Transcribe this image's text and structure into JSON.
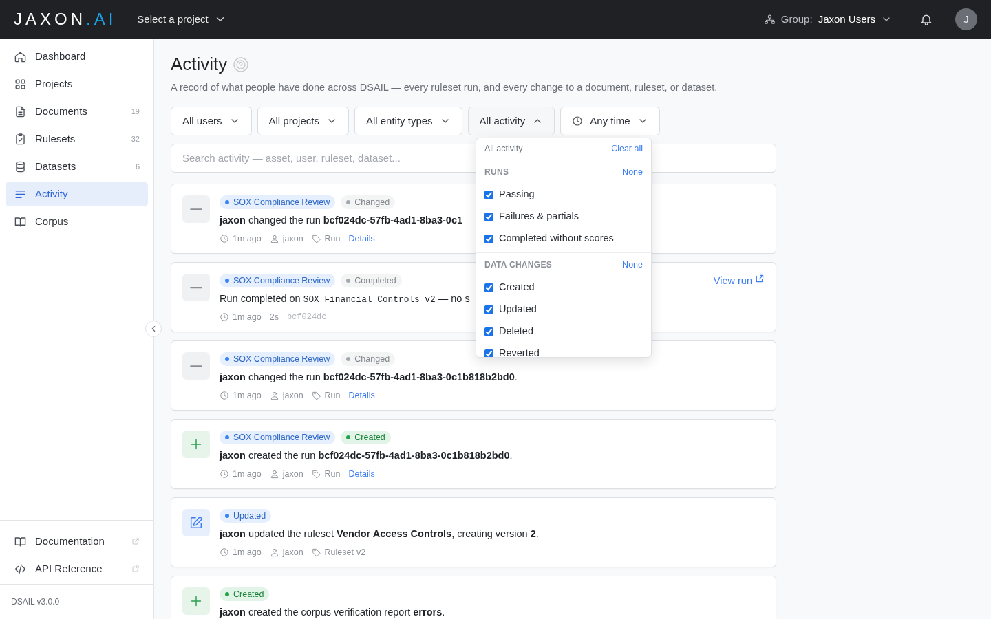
{
  "navbar": {
    "logo": {
      "main": "JAXON",
      "accent": ".AI"
    },
    "project_selector": "Select a project",
    "group": {
      "label": "Group:",
      "value": "Jaxon Users"
    },
    "avatar": "J"
  },
  "sidebar": {
    "items": [
      {
        "label": "Dashboard",
        "kind": "home",
        "selected": false
      },
      {
        "label": "Projects",
        "kind": "grid",
        "selected": false
      },
      {
        "label": "Documents",
        "kind": "doc",
        "count": "19",
        "selected": false
      },
      {
        "label": "Rulesets",
        "kind": "clipboard",
        "count": "32",
        "selected": false
      },
      {
        "label": "Datasets",
        "kind": "database",
        "count": "6",
        "selected": false
      },
      {
        "label": "Activity",
        "kind": "lines",
        "selected": true
      },
      {
        "label": "Corpus",
        "kind": "book",
        "selected": false
      }
    ],
    "links": [
      {
        "label": "Documentation",
        "kind": "book"
      },
      {
        "label": "API Reference",
        "kind": "code"
      }
    ],
    "version": "DSAIL v3.0.0"
  },
  "page": {
    "title": "Activity",
    "subtitle": "A record of what people have done across DSAIL — every ruleset run, and every change to a document, ruleset, or dataset."
  },
  "filters": [
    {
      "label": "All users",
      "kind": "select",
      "expanded": false
    },
    {
      "label": "All projects",
      "kind": "select",
      "expanded": false
    },
    {
      "label": "All entity types",
      "kind": "select",
      "expanded": false
    },
    {
      "label": "All activity",
      "kind": "select",
      "expanded": true
    },
    {
      "label": "Any time",
      "kind": "time",
      "expanded": false
    }
  ],
  "search": {
    "placeholder": "Search activity — asset, user, ruleset, dataset..."
  },
  "dropdown": {
    "title": "All activity",
    "clear": "Clear all",
    "sections": [
      {
        "title": "RUNS",
        "action": "None",
        "options": [
          {
            "label": "Passing",
            "checked": true
          },
          {
            "label": "Failures & partials",
            "checked": true
          },
          {
            "label": "Completed without scores",
            "checked": true
          }
        ]
      },
      {
        "title": "DATA CHANGES",
        "action": "None",
        "options": [
          {
            "label": "Created",
            "checked": true
          },
          {
            "label": "Updated",
            "checked": true
          },
          {
            "label": "Deleted",
            "checked": true
          },
          {
            "label": "Reverted",
            "checked": true
          }
        ]
      }
    ]
  },
  "activities": [
    {
      "kind": "neutral",
      "tags": [
        {
          "text": "SOX Compliance Review",
          "color": "#3b82f6"
        },
        {
          "text": "Changed",
          "color": "#a3a7ae"
        }
      ],
      "message": [
        {
          "kind": "bold",
          "text": "jaxon"
        },
        {
          "kind": "text",
          "text": " changed the run "
        },
        {
          "kind": "bold",
          "text": "bcf024dc-57fb-4ad1-8ba3-0c1"
        }
      ],
      "meta": [
        {
          "kind": "time",
          "text": "1m ago"
        },
        {
          "kind": "user",
          "text": "jaxon"
        },
        {
          "kind": "type",
          "text": "Run"
        },
        {
          "kind": "link",
          "text": "Details"
        }
      ]
    },
    {
      "kind": "neutral",
      "tags": [
        {
          "text": "SOX Compliance Review",
          "color": "#3b82f6"
        },
        {
          "text": "Completed",
          "color": "#a3a7ae"
        }
      ],
      "message": [
        {
          "kind": "text",
          "text": "Run completed on "
        },
        {
          "kind": "code",
          "text": "SOX Financial Controls v2"
        },
        {
          "kind": "text",
          "text": " — no s"
        }
      ],
      "meta": [
        {
          "kind": "time",
          "text": "1m ago"
        },
        {
          "kind": "plain",
          "text": "2s"
        },
        {
          "kind": "hash",
          "text": "bcf024dc"
        }
      ],
      "action": "View run"
    },
    {
      "kind": "neutral",
      "tags": [
        {
          "text": "SOX Compliance Review",
          "color": "#3b82f6"
        },
        {
          "text": "Changed",
          "color": "#a3a7ae"
        }
      ],
      "message": [
        {
          "kind": "bold",
          "text": "jaxon"
        },
        {
          "kind": "text",
          "text": " changed the run "
        },
        {
          "kind": "bold",
          "text": "bcf024dc-57fb-4ad1-8ba3-0c1b818b2bd0"
        },
        {
          "kind": "text",
          "text": "."
        }
      ],
      "meta": [
        {
          "kind": "time",
          "text": "1m ago"
        },
        {
          "kind": "user",
          "text": "jaxon"
        },
        {
          "kind": "type",
          "text": "Run"
        },
        {
          "kind": "link",
          "text": "Details"
        }
      ]
    },
    {
      "kind": "created",
      "tags": [
        {
          "text": "SOX Compliance Review",
          "color": "#3b82f6"
        },
        {
          "text": "Created",
          "color": "#22a34a"
        }
      ],
      "message": [
        {
          "kind": "bold",
          "text": "jaxon"
        },
        {
          "kind": "text",
          "text": " created the run "
        },
        {
          "kind": "bold",
          "text": "bcf024dc-57fb-4ad1-8ba3-0c1b818b2bd0"
        },
        {
          "kind": "text",
          "text": "."
        }
      ],
      "meta": [
        {
          "kind": "time",
          "text": "1m ago"
        },
        {
          "kind": "user",
          "text": "jaxon"
        },
        {
          "kind": "type",
          "text": "Run"
        },
        {
          "kind": "link",
          "text": "Details"
        }
      ]
    },
    {
      "kind": "updated",
      "tags": [
        {
          "text": "Updated",
          "color": "#3b82f6"
        }
      ],
      "message": [
        {
          "kind": "bold",
          "text": "jaxon"
        },
        {
          "kind": "text",
          "text": " updated the ruleset "
        },
        {
          "kind": "bold",
          "text": "Vendor Access Controls"
        },
        {
          "kind": "text",
          "text": ", creating version "
        },
        {
          "kind": "bold",
          "text": "2"
        },
        {
          "kind": "text",
          "text": "."
        }
      ],
      "meta": [
        {
          "kind": "time",
          "text": "1m ago"
        },
        {
          "kind": "user",
          "text": "jaxon"
        },
        {
          "kind": "type",
          "text": "Ruleset"
        },
        {
          "kind": "version",
          "text": "v2"
        }
      ]
    },
    {
      "kind": "created",
      "tags": [
        {
          "text": "Created",
          "color": "#22a34a"
        }
      ],
      "message": [
        {
          "kind": "bold",
          "text": "jaxon"
        },
        {
          "kind": "text",
          "text": " created the corpus verification report "
        },
        {
          "kind": "bold",
          "text": "errors"
        },
        {
          "kind": "text",
          "text": "."
        }
      ]
    }
  ]
}
